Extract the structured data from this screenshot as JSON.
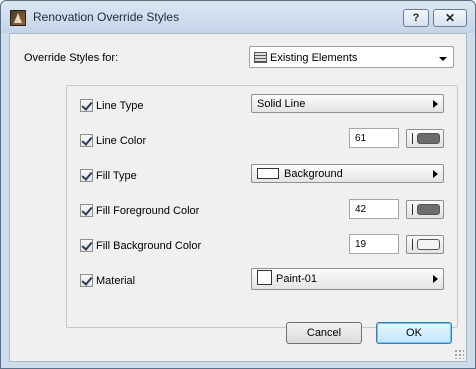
{
  "window": {
    "title": "Renovation Override Styles",
    "help_label": "?",
    "close_label": "✕"
  },
  "override_for": {
    "label": "Override Styles for:",
    "value": "Existing Elements",
    "icon": "brick-wall-icon"
  },
  "rows": {
    "line_type": {
      "label": "Line Type",
      "checked": true,
      "value": "Solid Line"
    },
    "line_color": {
      "label": "Line Color",
      "checked": true,
      "value": "61",
      "pen_color": "#6b6b6b"
    },
    "fill_type": {
      "label": "Fill Type",
      "checked": true,
      "value": "Background"
    },
    "fill_fg_color": {
      "label": "Fill Foreground Color",
      "checked": true,
      "value": "42",
      "pen_color": "#6e6e6e"
    },
    "fill_bg_color": {
      "label": "Fill Background Color",
      "checked": true,
      "value": "19",
      "pen_color": "#f4f4f4"
    },
    "material": {
      "label": "Material",
      "checked": true,
      "value": "Paint-01"
    }
  },
  "buttons": {
    "cancel": "Cancel",
    "ok": "OK"
  },
  "colors": {
    "title_bar": "#c4d4e8",
    "default_button": "#bee6fd"
  }
}
